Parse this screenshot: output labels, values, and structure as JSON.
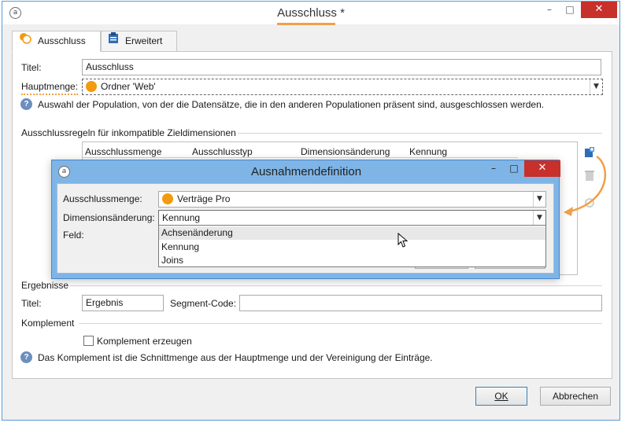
{
  "window": {
    "title": "Ausschluss *",
    "minimize": "–",
    "maximize": "□",
    "close": "✕"
  },
  "tabs": [
    {
      "label": "Ausschluss",
      "icon": "exclusion-icon"
    },
    {
      "label": "Erweitert",
      "icon": "clipboard-icon"
    }
  ],
  "form": {
    "title_label": "Titel:",
    "title_value": "Ausschluss",
    "main_set_label": "Hauptmenge:",
    "main_set_value": "Ordner 'Web'",
    "help_main": "Auswahl der Population, von der die Datensätze, die in den anderen Populationen präsent sind, ausgeschlossen werden."
  },
  "rules": {
    "section_title": "Ausschlussregeln für inkompatible Zieldimensionen",
    "columns": [
      "Ausschlussmenge",
      "Ausschlusstyp",
      "Dimensionsänderung",
      "Kennung"
    ]
  },
  "results": {
    "section_title": "Ergebnisse",
    "title_label": "Titel:",
    "title_value": "Ergebnis",
    "segment_label": "Segment-Code:",
    "segment_value": ""
  },
  "complement": {
    "section_title": "Komplement",
    "checkbox_label": "Komplement erzeugen",
    "checked": false,
    "help": "Das Komplement ist die Schnittmenge aus der Hauptmenge und der Vereinigung der Einträge."
  },
  "buttons": {
    "ok": "OK",
    "cancel": "Abbrechen"
  },
  "dialog": {
    "title": "Ausnahmendefinition",
    "minimize": "–",
    "maximize": "□",
    "close": "✕",
    "exclusion_set_label": "Ausschlussmenge:",
    "exclusion_set_value": "Verträge Pro",
    "dimension_change_label": "Dimensionsänderung:",
    "dimension_change_value": "Kennung",
    "field_label": "Feld:",
    "dropdown_options": [
      "Achsenänderung",
      "Kennung",
      "Joins"
    ],
    "highlighted_option": "Achsenänderung"
  },
  "colors": {
    "accent_orange": "#f29b0f",
    "title_underline": "#f0a048",
    "close_red": "#c7302b",
    "dialog_frame": "#7fb4e6",
    "arrow_orange": "#f0a048"
  }
}
